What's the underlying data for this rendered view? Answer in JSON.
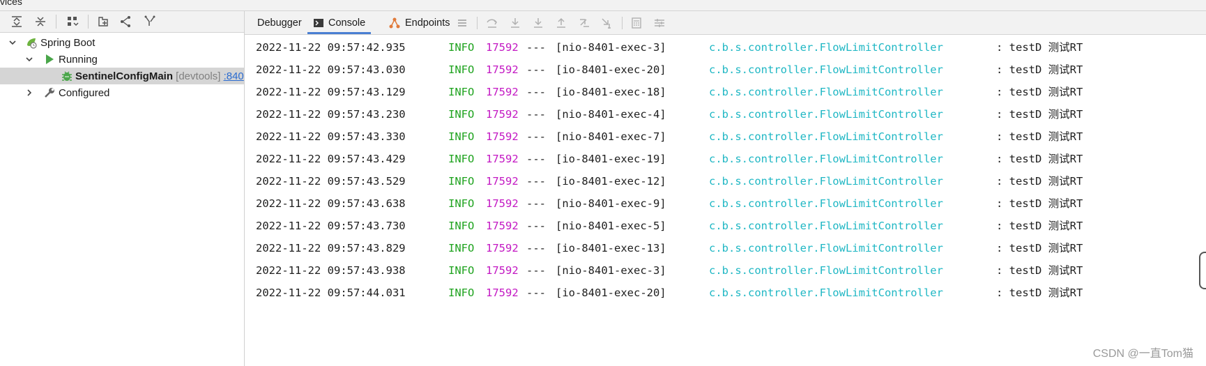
{
  "window": {
    "title_fragment": "vices"
  },
  "colors": {
    "info": "#1fa31f",
    "pid": "#c318c3",
    "class": "#1fb7c4",
    "active_tab": "#4a7fd2",
    "spring": "#6db33f"
  },
  "services": {
    "toolbar": [
      {
        "name": "expand-all-icon"
      },
      {
        "name": "collapse-all-icon"
      },
      {
        "name": "group-by-icon"
      },
      {
        "name": "add-service-icon"
      },
      {
        "name": "split-icon"
      },
      {
        "name": "filter-icon"
      }
    ],
    "tree": {
      "root": {
        "label": "Spring Boot",
        "icon": "spring-boot-icon"
      },
      "running": {
        "label": "Running",
        "icon": "run-icon"
      },
      "app": {
        "name": "SentinelConfigMain",
        "tag": "[devtools]",
        "port": ":840",
        "icon": "debug-bug-icon"
      },
      "configured": {
        "label": "Configured",
        "icon": "wrench-icon"
      }
    }
  },
  "console": {
    "tabs": [
      {
        "label": "Debugger",
        "active": false
      },
      {
        "label": "Console",
        "active": true
      },
      {
        "label": "Endpoints",
        "active": false
      }
    ],
    "toolbar": [
      {
        "name": "menu-icon"
      },
      {
        "name": "step-over-icon"
      },
      {
        "name": "step-into-icon"
      },
      {
        "name": "force-step-into-icon"
      },
      {
        "name": "step-out-icon"
      },
      {
        "name": "drop-frame-icon"
      },
      {
        "name": "run-to-cursor-icon"
      },
      {
        "name": "evaluate-icon"
      },
      {
        "name": "trace-icon"
      }
    ],
    "log": [
      {
        "date": "2022-11-22 09:57:42.935",
        "level": "INFO",
        "pid": "17592",
        "dash": "---",
        "thread": "[nio-8401-exec-3]",
        "cls": "c.b.s.controller.FlowLimitController",
        "msg": ": testD 测试RT"
      },
      {
        "date": "2022-11-22 09:57:43.030",
        "level": "INFO",
        "pid": "17592",
        "dash": "---",
        "thread": "[io-8401-exec-20]",
        "cls": "c.b.s.controller.FlowLimitController",
        "msg": ": testD 测试RT"
      },
      {
        "date": "2022-11-22 09:57:43.129",
        "level": "INFO",
        "pid": "17592",
        "dash": "---",
        "thread": "[io-8401-exec-18]",
        "cls": "c.b.s.controller.FlowLimitController",
        "msg": ": testD 测试RT"
      },
      {
        "date": "2022-11-22 09:57:43.230",
        "level": "INFO",
        "pid": "17592",
        "dash": "---",
        "thread": "[nio-8401-exec-4]",
        "cls": "c.b.s.controller.FlowLimitController",
        "msg": ": testD 测试RT"
      },
      {
        "date": "2022-11-22 09:57:43.330",
        "level": "INFO",
        "pid": "17592",
        "dash": "---",
        "thread": "[nio-8401-exec-7]",
        "cls": "c.b.s.controller.FlowLimitController",
        "msg": ": testD 测试RT"
      },
      {
        "date": "2022-11-22 09:57:43.429",
        "level": "INFO",
        "pid": "17592",
        "dash": "---",
        "thread": "[io-8401-exec-19]",
        "cls": "c.b.s.controller.FlowLimitController",
        "msg": ": testD 测试RT"
      },
      {
        "date": "2022-11-22 09:57:43.529",
        "level": "INFO",
        "pid": "17592",
        "dash": "---",
        "thread": "[io-8401-exec-12]",
        "cls": "c.b.s.controller.FlowLimitController",
        "msg": ": testD 测试RT"
      },
      {
        "date": "2022-11-22 09:57:43.638",
        "level": "INFO",
        "pid": "17592",
        "dash": "---",
        "thread": "[nio-8401-exec-9]",
        "cls": "c.b.s.controller.FlowLimitController",
        "msg": ": testD 测试RT"
      },
      {
        "date": "2022-11-22 09:57:43.730",
        "level": "INFO",
        "pid": "17592",
        "dash": "---",
        "thread": "[nio-8401-exec-5]",
        "cls": "c.b.s.controller.FlowLimitController",
        "msg": ": testD 测试RT"
      },
      {
        "date": "2022-11-22 09:57:43.829",
        "level": "INFO",
        "pid": "17592",
        "dash": "---",
        "thread": "[io-8401-exec-13]",
        "cls": "c.b.s.controller.FlowLimitController",
        "msg": ": testD 测试RT"
      },
      {
        "date": "2022-11-22 09:57:43.938",
        "level": "INFO",
        "pid": "17592",
        "dash": "---",
        "thread": "[nio-8401-exec-3]",
        "cls": "c.b.s.controller.FlowLimitController",
        "msg": ": testD 测试RT"
      },
      {
        "date": "2022-11-22 09:57:44.031",
        "level": "INFO",
        "pid": "17592",
        "dash": "---",
        "thread": "[io-8401-exec-20]",
        "cls": "c.b.s.controller.FlowLimitController",
        "msg": ": testD 测试RT"
      }
    ]
  },
  "watermark": "CSDN @一直Tom猫"
}
